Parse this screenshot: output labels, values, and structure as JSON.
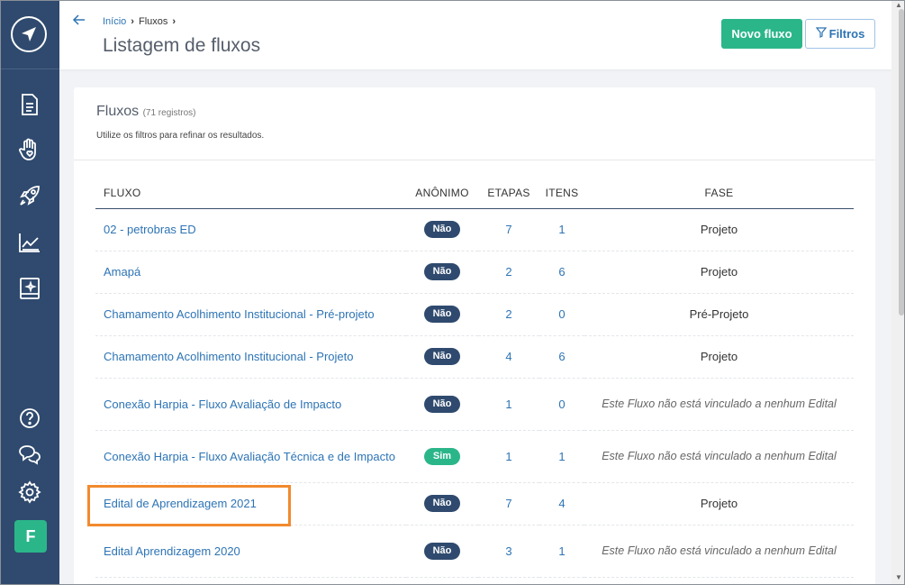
{
  "breadcrumb": {
    "home": "Início",
    "current": "Fluxos"
  },
  "page_title": "Listagem de fluxos",
  "actions": {
    "new_flow": "Novo fluxo",
    "filters": "Filtros"
  },
  "card": {
    "title": "Fluxos",
    "count": "(71 registros)",
    "hint": "Utilize os filtros para refinar os resultados."
  },
  "table": {
    "headers": {
      "flow": "FLUXO",
      "anonymous": "ANÔNIMO",
      "steps": "ETAPAS",
      "items": "ITENS",
      "phase": "FASE"
    },
    "rows": [
      {
        "name": "02 - petrobras ED",
        "anon": "Não",
        "steps": "7",
        "items": "1",
        "phase": "Projeto"
      },
      {
        "name": "Amapá",
        "anon": "Não",
        "steps": "2",
        "items": "6",
        "phase": "Projeto"
      },
      {
        "name": "Chamamento Acolhimento Institucional - Pré-projeto",
        "anon": "Não",
        "steps": "2",
        "items": "0",
        "phase": "Pré-Projeto"
      },
      {
        "name": "Chamamento Acolhimento Institucional - Projeto",
        "anon": "Não",
        "steps": "4",
        "items": "6",
        "phase": "Projeto"
      },
      {
        "name": "Conexão Harpia - Fluxo Avaliação de Impacto",
        "anon": "Não",
        "steps": "1",
        "items": "0",
        "phase": "Este Fluxo não está vinculado a nenhum Edital"
      },
      {
        "name": "Conexão Harpia - Fluxo Avaliação Técnica e de Impacto",
        "anon": "Sim",
        "steps": "1",
        "items": "1",
        "phase": "Este Fluxo não está vinculado a nenhum Edital"
      },
      {
        "name": "Edital de Aprendizagem 2021",
        "anon": "Não",
        "steps": "7",
        "items": "4",
        "phase": "Projeto"
      },
      {
        "name": "Edital Aprendizagem 2020",
        "anon": "Não",
        "steps": "3",
        "items": "1",
        "phase": "Este Fluxo não está vinculado a nenhum Edital"
      }
    ]
  },
  "user": {
    "initial": "F"
  },
  "colors": {
    "sidebar": "#2f4a6e",
    "accent_green": "#2bb68a",
    "link_blue": "#2d74b5",
    "highlight": "#f28a2e"
  }
}
